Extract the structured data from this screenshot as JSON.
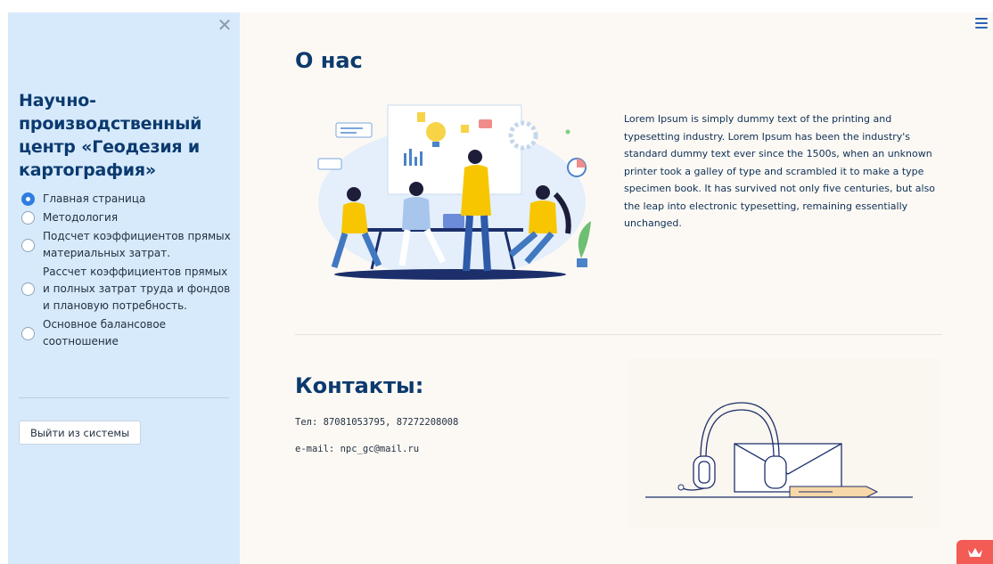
{
  "sidebar": {
    "org_title": "Научно-производственный центр «Геодезия и картография»",
    "nav": [
      {
        "label": "Главная страница",
        "selected": true
      },
      {
        "label": "Методология",
        "selected": false
      },
      {
        "label": "Подсчет коэффициентов прямых материальных затрат.",
        "selected": false
      },
      {
        "label": "Рассчет коэффициентов прямых и полных затрат труда и фондов и плановую потребность.",
        "selected": false
      },
      {
        "label": "Основное балансовое соотношение",
        "selected": false
      }
    ],
    "logout_label": "Выйти из системы",
    "icons": {
      "close": "close-icon"
    }
  },
  "main": {
    "about_heading": "О нас",
    "about_text": "Lorem Ipsum is simply dummy text of the printing and typesetting industry. Lorem Ipsum has been the industry's standard dummy text ever since the 1500s, when an unknown printer took a galley of type and scrambled it to make a type specimen book. It has survived not only five centuries, but also the leap into electronic typesetting, remaining essentially unchanged.",
    "contacts_heading": "Контакты:",
    "phone_line": "Тел: 87081053795, 87272208008",
    "email_line": "e-mail: npc_gc@mail.ru",
    "icons": {
      "menu": "hamburger-menu-icon",
      "badge": "crown-icon"
    }
  },
  "colors": {
    "sidebar_bg": "#d6eafc",
    "main_bg": "#fcf9f4",
    "heading": "#0b3a6e",
    "accent": "#2f7de1",
    "badge": "#f25c54"
  }
}
